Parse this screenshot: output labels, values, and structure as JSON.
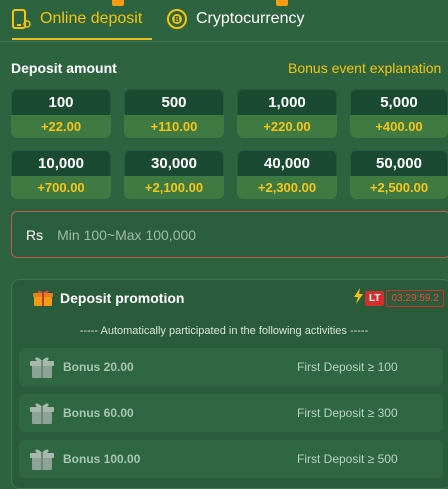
{
  "tabs": [
    {
      "label": "Online deposit",
      "active": true,
      "icon": "phone-deposit-icon"
    },
    {
      "label": "Cryptocurrency",
      "active": false,
      "icon": "crypto-coin-icon"
    }
  ],
  "deposit": {
    "title": "Deposit amount",
    "bonus_link": "Bonus event explanation"
  },
  "amounts": [
    {
      "value": "100",
      "bonus": "+22.00"
    },
    {
      "value": "500",
      "bonus": "+110.00"
    },
    {
      "value": "1,000",
      "bonus": "+220.00"
    },
    {
      "value": "5,000",
      "bonus": "+400.00"
    },
    {
      "value": "10,000",
      "bonus": "+700.00"
    },
    {
      "value": "30,000",
      "bonus": "+2,100.00"
    },
    {
      "value": "40,000",
      "bonus": "+2,300.00"
    },
    {
      "value": "50,000",
      "bonus": "+2,500.00"
    }
  ],
  "input": {
    "currency": "Rs",
    "placeholder": "Min 100~Max 100,000",
    "value": ""
  },
  "promotion": {
    "title": "Deposit promotion",
    "badge": "LT",
    "timer": "03:29:59.2",
    "note": "----- Automatically participated in the following activities -----",
    "items": [
      {
        "name": "Bonus 20.00",
        "condition": "First Deposit ≥ 100"
      },
      {
        "name": "Bonus 60.00",
        "condition": "First Deposit ≥ 300"
      },
      {
        "name": "Bonus 100.00",
        "condition": "First Deposit ≥ 500"
      }
    ]
  },
  "colors": {
    "background": "#2e6340",
    "accent": "#f1c40f",
    "bonus_text": "#f5c518",
    "alert_red": "#d0312d"
  }
}
